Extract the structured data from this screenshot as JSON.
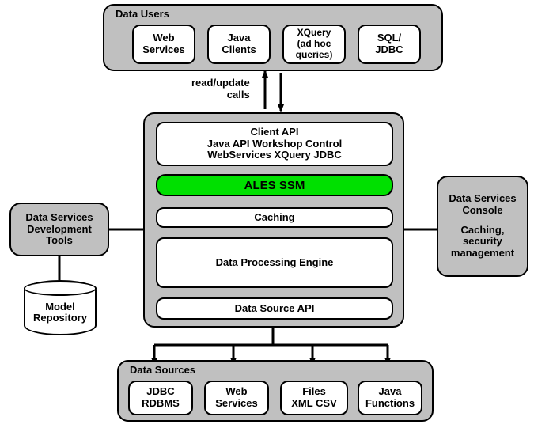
{
  "dataUsers": {
    "title": "Data Users",
    "items": [
      "Web\nServices",
      "Java\nClients",
      "XQuery\n(ad hoc\nqueries)",
      "SQL/\nJDBC"
    ]
  },
  "edgeLabel": "read/update\ncalls",
  "devTools": {
    "title": "Data Services\nDevelopment\nTools"
  },
  "modelRepo": "Model\nRepository",
  "core": {
    "clientApi": {
      "line1": "Client API",
      "line2": "Java API Workshop Control",
      "line3": "WebServices XQuery JDBC"
    },
    "alesSsm": "ALES SSM",
    "caching": "Caching",
    "engine": "Data Processing Engine",
    "dsApi": "Data Source API"
  },
  "console": {
    "title": "Data Services\nConsole",
    "subtitle": "Caching,\nsecurity\nmanagement"
  },
  "dataSources": {
    "title": "Data Sources",
    "items": [
      "JDBC\nRDBMS",
      "Web\nServices",
      "Files\nXML CSV",
      "Java\nFunctions"
    ]
  }
}
